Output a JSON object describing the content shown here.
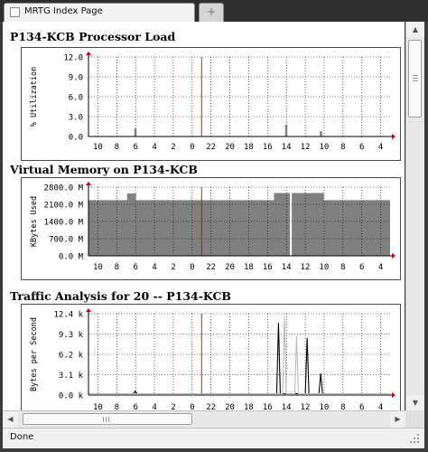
{
  "tab": {
    "title": "MRTG Index Page",
    "new_tab_label": "+"
  },
  "status": {
    "text": "Done"
  },
  "graphs": [
    {
      "title": "P134-KCB Processor Load",
      "chart_data": {
        "type": "area",
        "ylabel": "% Utilization",
        "y_ticks": [
          "12.0",
          "9.0",
          "6.0",
          "3.0",
          "0.0"
        ],
        "ylim": [
          0,
          12
        ],
        "x_ticks": [
          "10",
          "8",
          "6",
          "4",
          "2",
          "0",
          "22",
          "20",
          "18",
          "16",
          "14",
          "12",
          "10",
          "8",
          "6",
          "4"
        ],
        "series": [
          {
            "color": "#808080",
            "spikes": [
              [
                0.155,
                1.2
              ],
              [
                0.655,
                1.8
              ],
              [
                0.77,
                0.8
              ]
            ]
          }
        ]
      }
    },
    {
      "title": "Virtual Memory on P134-KCB",
      "chart_data": {
        "type": "area",
        "ylabel": "KBytes Used",
        "y_ticks": [
          "2800.0 M",
          "2100.0 M",
          "1400.0 M",
          "700.0 M",
          "0.0 M"
        ],
        "ylim": [
          0,
          2800
        ],
        "x_ticks": [
          "10",
          "8",
          "6",
          "4",
          "2",
          "0",
          "22",
          "20",
          "18",
          "16",
          "14",
          "12",
          "10",
          "8",
          "6",
          "4"
        ],
        "series": [
          {
            "color": "#808080",
            "base_level": 2270,
            "bumps": [
              [
                0.128,
                0.157,
                2540
              ],
              [
                0.615,
                0.78,
                2560
              ]
            ],
            "gap_at": 0.668
          }
        ]
      }
    },
    {
      "title": "Traffic Analysis for 20 -- P134-KCB",
      "chart_data": {
        "type": "line",
        "ylabel": "Bytes per Second",
        "y_ticks": [
          "12.4 k",
          "9.3 k",
          "6.2 k",
          "3.1 k",
          "0.0 k"
        ],
        "ylim": [
          0,
          12.4
        ],
        "x_ticks": [
          "10",
          "8",
          "6",
          "4",
          "2",
          "0",
          "22",
          "20",
          "18",
          "16",
          "14",
          "12",
          "10",
          "8",
          "6",
          "4"
        ],
        "series": [
          {
            "color": "#000000",
            "peaks": [
              [
                0.63,
                11.0
              ],
              [
                0.725,
                8.7
              ],
              [
                0.77,
                3.3
              ],
              [
                0.155,
                0.6
              ]
            ]
          },
          {
            "color": "#bbbbbb",
            "peaks": [
              [
                0.65,
                12.0
              ],
              [
                0.69,
                9.0
              ]
            ]
          }
        ]
      }
    }
  ]
}
